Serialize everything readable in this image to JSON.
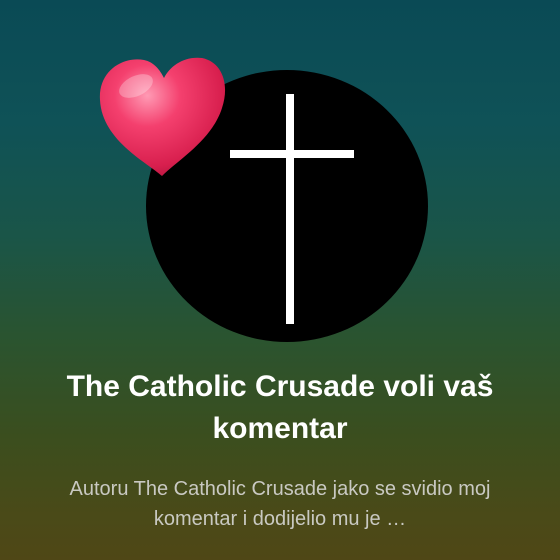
{
  "notification": {
    "title": "The Catholic Crusade voli vaš komentar",
    "body": "Autoru The Catholic Crusade jako se svidio moj komentar i dodijelio mu je …"
  },
  "icons": {
    "avatar": "cross-icon",
    "reaction": "heart-icon"
  },
  "colors": {
    "avatar_background": "#000000",
    "cross": "#ffffff",
    "heart": "#e8285a",
    "title": "#ffffff",
    "body": "#c9c9c2"
  }
}
